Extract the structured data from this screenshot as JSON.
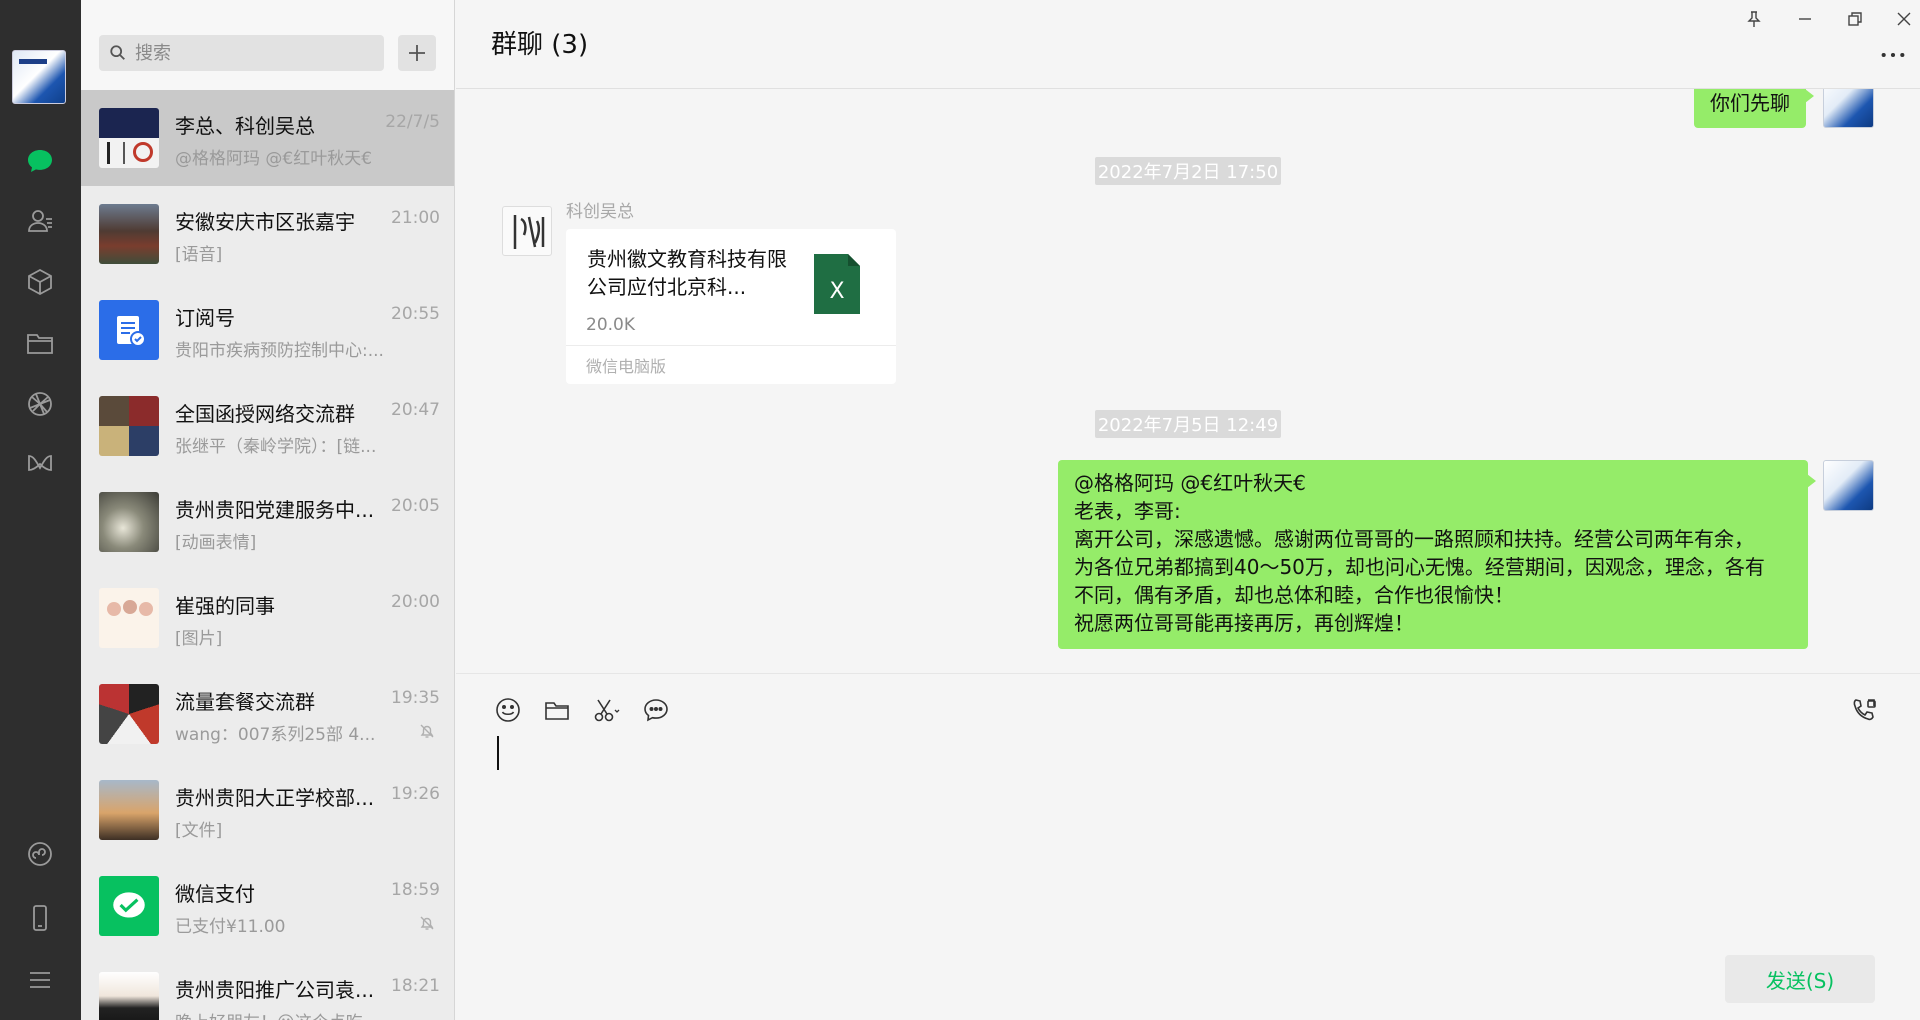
{
  "sidebar": {
    "nav_icons": [
      "chat-icon",
      "contacts-icon",
      "favorites-icon",
      "files-icon",
      "moments-icon",
      "channels-icon",
      "miniprogram-icon",
      "phone-icon",
      "menu-icon"
    ]
  },
  "search": {
    "placeholder": "搜索"
  },
  "conversations": [
    {
      "name": "李总、科创吴总",
      "time": "22/7/5",
      "preview": "@格格阿玛 @€红叶秋天€",
      "muted": false
    },
    {
      "name": "安徽安庆市区张嘉宇",
      "time": "21:00",
      "preview": "[语音]",
      "muted": false
    },
    {
      "name": "订阅号",
      "time": "20:55",
      "preview": "贵阳市疾病预防控制中心:...",
      "muted": false
    },
    {
      "name": "全国函授网络交流群",
      "time": "20:47",
      "preview": "张继平（秦岭学院）：[链...",
      "muted": false
    },
    {
      "name": "贵州贵阳党建服务中...",
      "time": "20:05",
      "preview": "[动画表情]",
      "muted": false
    },
    {
      "name": "崔强的同事",
      "time": "20:00",
      "preview": "[图片]",
      "muted": false
    },
    {
      "name": "流量套餐交流群",
      "time": "19:35",
      "preview": "wang：007系列25部 4...",
      "muted": true
    },
    {
      "name": "贵州贵阳大正学校部...",
      "time": "19:26",
      "preview": "[文件]",
      "muted": false
    },
    {
      "name": "微信支付",
      "time": "18:59",
      "preview": "已支付¥11.00",
      "muted": true
    },
    {
      "name": "贵州贵阳推广公司袁...",
      "time": "18:21",
      "preview": "晚上好朋友！😮这个点吃...",
      "muted": false
    }
  ],
  "chat": {
    "title": "群聊 (3)",
    "messages": {
      "m1_text": "你们先聊",
      "stamp1": "2022年7月2日 17:50",
      "sender": "科创吴总",
      "file_name": "贵州徽文教育科技有限公司应付北京科...",
      "file_size": "20.0K",
      "file_source": "微信电脑版",
      "stamp2": "2022年7月5日 12:49",
      "m2_lines": [
        "@格格阿玛 @€红叶秋天€",
        "老表，李哥:",
        "离开公司，深感遗憾。感谢两位哥哥的一路照顾和扶持。经营公司两年有余，",
        "为各位兄弟都搞到40～50万，却也问心无愧。经营期间，因观念，理念，各有",
        "不同，偶有矛盾，却也总体和睦，合作也很愉快！",
        "祝愿两位哥哥能再接再厉，再创辉煌！"
      ]
    },
    "send_label": "发送(S)"
  },
  "colors": {
    "bubble_green": "#95ec69",
    "send_text": "#07c160",
    "sidebar_bg": "#2e2e2e",
    "excel_green": "#1f6e43"
  }
}
